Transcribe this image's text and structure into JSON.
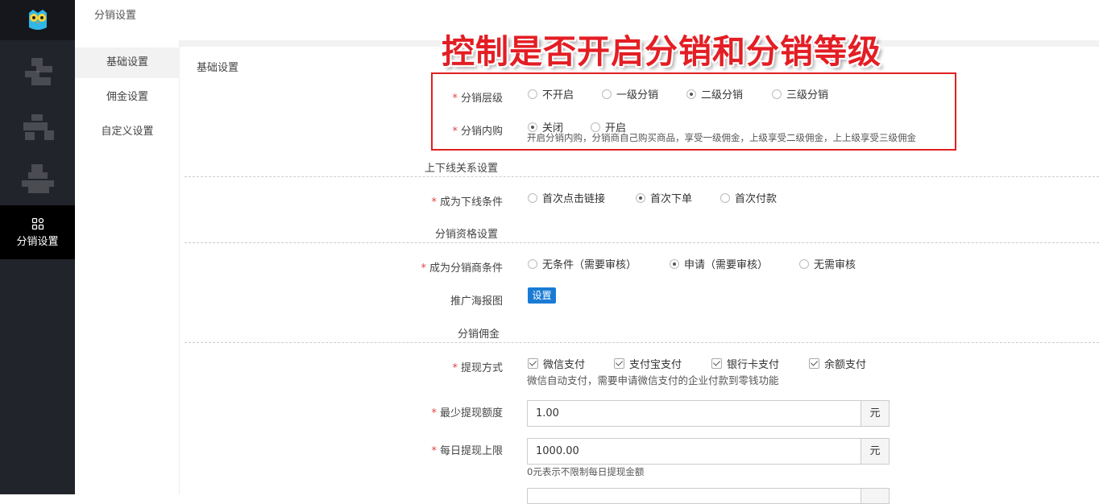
{
  "header": {
    "title": "分销设置"
  },
  "sidebar": {
    "active_label": "分销设置"
  },
  "subnav": {
    "items": [
      "基础设置",
      "佣金设置",
      "自定义设置"
    ]
  },
  "section": {
    "title": "基础设置"
  },
  "annotation": {
    "banner": "控制是否开启分销和分销等级"
  },
  "level": {
    "label": "分销层级",
    "options": [
      "不开启",
      "一级分销",
      "二级分销",
      "三级分销"
    ],
    "selected": "二级分销"
  },
  "self_buy": {
    "label": "分销内购",
    "options": [
      "关闭",
      "开启"
    ],
    "selected": "关闭",
    "hint": "开启分销内购，分销商自己购买商品，享受一级佣金，上级享受二级佣金，上上级享受三级佣金"
  },
  "relation": {
    "group_title": "上下线关系设置",
    "label": "成为下线条件",
    "options": [
      "首次点击链接",
      "首次下单",
      "首次付款"
    ],
    "selected": "首次下单"
  },
  "qualification": {
    "group_title": "分销资格设置",
    "label": "成为分销商条件",
    "options": [
      "无条件（需要审核）",
      "申请（需要审核）",
      "无需审核"
    ],
    "selected": "申请（需要审核）"
  },
  "poster": {
    "label": "推广海报图",
    "button": "设置"
  },
  "commission": {
    "group_title": "分销佣金",
    "withdraw_label": "提现方式",
    "withdraw_options": [
      "微信支付",
      "支付宝支付",
      "银行卡支付",
      "余额支付"
    ],
    "withdraw_hint": "微信自动支付，需要申请微信支付的企业付款到零钱功能",
    "min_label": "最少提现额度",
    "min_value": "1.00",
    "daily_label": "每日提现上限",
    "daily_value": "1000.00",
    "daily_hint": "0元表示不限制每日提现金额",
    "unit": "元"
  },
  "colors": {
    "required": "#e04343",
    "accent": "#1a7bd5",
    "annotation": "#e31e24",
    "sidebar": "#22242c"
  }
}
